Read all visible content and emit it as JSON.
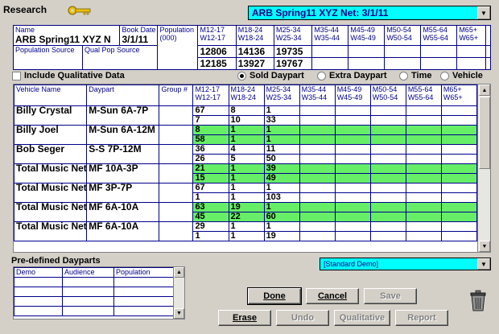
{
  "window": {
    "title": "Research"
  },
  "market_select": {
    "value": "ARB Spring11 XYZ Net: 3/1/11"
  },
  "header_grid": {
    "name_label": "Name",
    "name_value": "ARB Spring11 XYZ N",
    "book_label": "Book Date",
    "book_value": "3/1/11",
    "population_label": "Population (000)",
    "population_source_label": "Population Source",
    "qual_pop_source_label": "Qual Pop Source",
    "demos": [
      {
        "top": "M12-17",
        "bot": "W12-17"
      },
      {
        "top": "M18-24",
        "bot": "W18-24"
      },
      {
        "top": "M25-34",
        "bot": "W25-34"
      },
      {
        "top": "M35-44",
        "bot": "W35-44"
      },
      {
        "top": "M45-49",
        "bot": "W45-49"
      },
      {
        "top": "M50-54",
        "bot": "W50-54"
      },
      {
        "top": "M55-64",
        "bot": "W55-64"
      },
      {
        "top": "M65+",
        "bot": "W65+"
      },
      {
        "top": "",
        "bot": ""
      }
    ],
    "pop_row1": [
      "12806",
      "14136",
      "19735",
      "",
      "",
      "",
      "",
      "",
      ""
    ],
    "pop_row2": [
      "12185",
      "13927",
      "19767",
      "",
      "",
      "",
      "",
      "",
      ""
    ]
  },
  "options": {
    "include_qualitative": "Include Qualitative Data",
    "sold_daypart": "Sold Daypart",
    "extra_daypart": "Extra Daypart",
    "time": "Time",
    "vehicle": "Vehicle"
  },
  "main_grid": {
    "headers": {
      "vehicle": "Vehicle Name",
      "daypart": "Daypart",
      "group": "Group #"
    },
    "rows": [
      {
        "vehicle": "Billy Crystal",
        "daypart": "M-Sun 6A-7P",
        "green": false,
        "r1": [
          "67",
          "8",
          "1"
        ],
        "r2": [
          "7",
          "10",
          "33"
        ]
      },
      {
        "vehicle": "Billy Joel",
        "daypart": "M-Sun 6A-12M",
        "green": true,
        "r1": [
          "8",
          "1",
          "1"
        ],
        "r2": [
          "58",
          "1",
          "1"
        ]
      },
      {
        "vehicle": "Bob Seger",
        "daypart": "S-S 7P-12M",
        "green": false,
        "r1": [
          "36",
          "4",
          "11"
        ],
        "r2": [
          "26",
          "5",
          "50"
        ]
      },
      {
        "vehicle": "Total Music Net",
        "daypart": "MF 10A-3P",
        "green": true,
        "r1": [
          "21",
          "1",
          "39"
        ],
        "r2": [
          "15",
          "1",
          "49"
        ]
      },
      {
        "vehicle": "Total Music Net",
        "daypart": "MF 3P-7P",
        "green": false,
        "r1": [
          "67",
          "1",
          "1"
        ],
        "r2": [
          "1",
          "1",
          "103"
        ]
      },
      {
        "vehicle": "Total Music Net",
        "daypart": "MF 6A-10A",
        "green": true,
        "r1": [
          "63",
          "19",
          "1"
        ],
        "r2": [
          "45",
          "22",
          "60"
        ]
      },
      {
        "vehicle": "Total Music Net",
        "daypart": "MF 6A-10A",
        "green": false,
        "r1": [
          "29",
          "1",
          "1"
        ],
        "r2": [
          "1",
          "1",
          "19"
        ]
      }
    ]
  },
  "predefined": {
    "title": "Pre-defined Dayparts",
    "col_demo": "Demo",
    "col_audience": "Audience",
    "col_population": "Population"
  },
  "demo_select": {
    "value": "[Standard Demo]"
  },
  "buttons": {
    "done": "Done",
    "cancel": "Cancel",
    "save": "Save",
    "erase": "Erase",
    "undo": "Undo",
    "qualitative": "Qualitative",
    "report": "Report"
  },
  "colors": {
    "highlight": "#66ee66",
    "accent": "#00ffff",
    "grid_line": "#00008b"
  }
}
